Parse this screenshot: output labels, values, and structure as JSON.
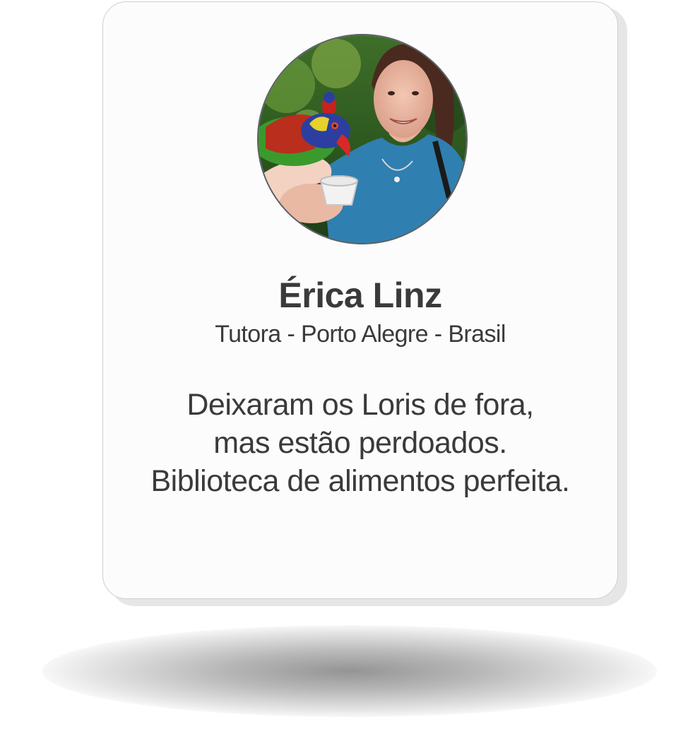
{
  "testimonial": {
    "name": "Érica Linz",
    "role": "Tutora - Porto Alegre - Brasil",
    "quote_lines": [
      "Deixaram os Loris de fora,",
      "mas estão perdoados.",
      "Biblioteca de alimentos perfeita."
    ]
  },
  "colors": {
    "card_background": "#fcfcfc",
    "card_border": "#cfcfcf",
    "text": "#3a3a3a",
    "avatar_ring": "#5c6066"
  }
}
